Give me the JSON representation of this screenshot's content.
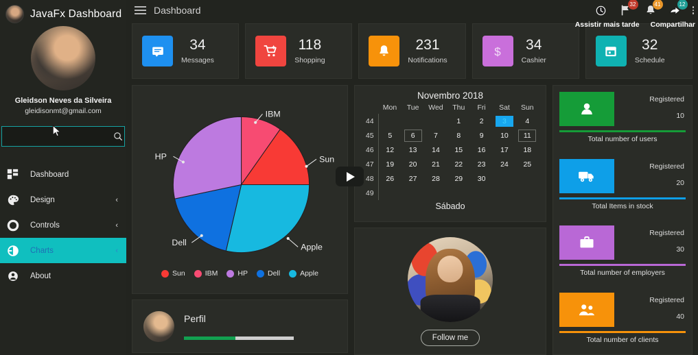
{
  "sidebar": {
    "app_title": "JavaFx Dashboard",
    "user_name": "Gleidson Neves da Silveira",
    "user_email": "gleidisonmt@gmail.com",
    "search": {
      "value": "",
      "placeholder": "",
      "icon": "search-icon"
    },
    "items": [
      {
        "label": "Dashboard",
        "icon": "grid-icon",
        "chevron": "",
        "active": false
      },
      {
        "label": "Design",
        "icon": "palette-icon",
        "chevron": "‹",
        "active": false
      },
      {
        "label": "Controls",
        "icon": "circle-icon",
        "chevron": "‹",
        "active": false
      },
      {
        "label": "Charts",
        "icon": "pie-chart-icon",
        "chevron": "‹",
        "active": true
      },
      {
        "label": "About",
        "icon": "person-icon",
        "chevron": "",
        "active": false
      }
    ]
  },
  "topbar": {
    "menu_icon": "hamburger-icon",
    "title": "Dashboard",
    "overlay_labels": [
      "Assistir mais tarde",
      "Compartilhar"
    ],
    "icons": [
      {
        "name": "watch-later-clock-icon",
        "badge": "",
        "badge_color": ""
      },
      {
        "name": "flag-icon",
        "badge": "32",
        "badge_color": "#c0392b"
      },
      {
        "name": "bell-icon",
        "badge": "41",
        "badge_color": "#e8962a"
      },
      {
        "name": "share-icon",
        "badge": "12",
        "badge_color": "#1f9e96"
      },
      {
        "name": "more-vertical-icon",
        "badge": "",
        "badge_color": ""
      }
    ]
  },
  "stats": [
    {
      "value": "34",
      "caption": "Messages",
      "icon": "message-icon",
      "color": "#1e90f0"
    },
    {
      "value": "118",
      "caption": "Shopping",
      "icon": "cart-icon",
      "color": "#f0453f"
    },
    {
      "value": "231",
      "caption": "Notifications",
      "icon": "bell-icon",
      "color": "#f7920a"
    },
    {
      "value": "34",
      "caption": "Cashier",
      "icon": "dollar-icon",
      "color": "#c96fdb"
    },
    {
      "value": "32",
      "caption": "Schedule",
      "icon": "calendar-icon",
      "color": "#0fb2b2"
    }
  ],
  "chart_data": {
    "type": "pie",
    "title": "",
    "categories": [
      "Sun",
      "IBM",
      "HP",
      "Dell",
      "Apple"
    ],
    "values": [
      15.3,
      9.7,
      28.3,
      18.1,
      28.6
    ],
    "colors": [
      "#f83a35",
      "#f74b72",
      "#bd7ae0",
      "#0f71e0",
      "#17b9e0"
    ],
    "labels": [
      "Sun",
      "IBM",
      "HP",
      "Dell",
      "Apple"
    ],
    "legend": [
      "Sun",
      "IBM",
      "HP",
      "Dell",
      "Apple"
    ],
    "legend_position": "bottom",
    "start_angle_deg": 0,
    "direction": "clockwise"
  },
  "perfil": {
    "title": "Perfil",
    "progress": 47,
    "bar_color": "#12a050",
    "avatar": "profile-avatar"
  },
  "calendar": {
    "title": "Novembro 2018",
    "weekday_headers": [
      "Mon",
      "Tue",
      "Wed",
      "Thu",
      "Fri",
      "Sat",
      "Sun"
    ],
    "week_numbers": [
      "44",
      "45",
      "46",
      "47",
      "48",
      "49"
    ],
    "rows": [
      [
        "",
        "",
        "",
        "1",
        "2",
        "3",
        "4"
      ],
      [
        "5",
        "6",
        "7",
        "8",
        "9",
        "10",
        "11"
      ],
      [
        "12",
        "13",
        "14",
        "15",
        "16",
        "17",
        "18"
      ],
      [
        "19",
        "20",
        "21",
        "22",
        "23",
        "24",
        "25"
      ],
      [
        "26",
        "27",
        "28",
        "29",
        "30",
        "",
        ""
      ],
      [
        "",
        "",
        "",
        "",
        "",
        "",
        ""
      ]
    ],
    "selected_day": "3",
    "outlined_days": [
      "6",
      "11"
    ],
    "footer": "Sábado"
  },
  "follow": {
    "button_label": "Follow me",
    "avatar": "follow-avatar"
  },
  "registered": [
    {
      "label": "Registered",
      "count": "10",
      "caption": "Total number of users",
      "icon": "person-icon",
      "color": "#159c38"
    },
    {
      "label": "Registered",
      "count": "20",
      "caption": "Total Items in stock",
      "icon": "truck-icon",
      "color": "#0e9fe8"
    },
    {
      "label": "Registered",
      "count": "30",
      "caption": "Total number of employers",
      "icon": "briefcase-icon",
      "color": "#b968d6"
    },
    {
      "label": "Registered",
      "count": "40",
      "caption": "Total number of clients",
      "icon": "people-icon",
      "color": "#f7920a"
    }
  ]
}
